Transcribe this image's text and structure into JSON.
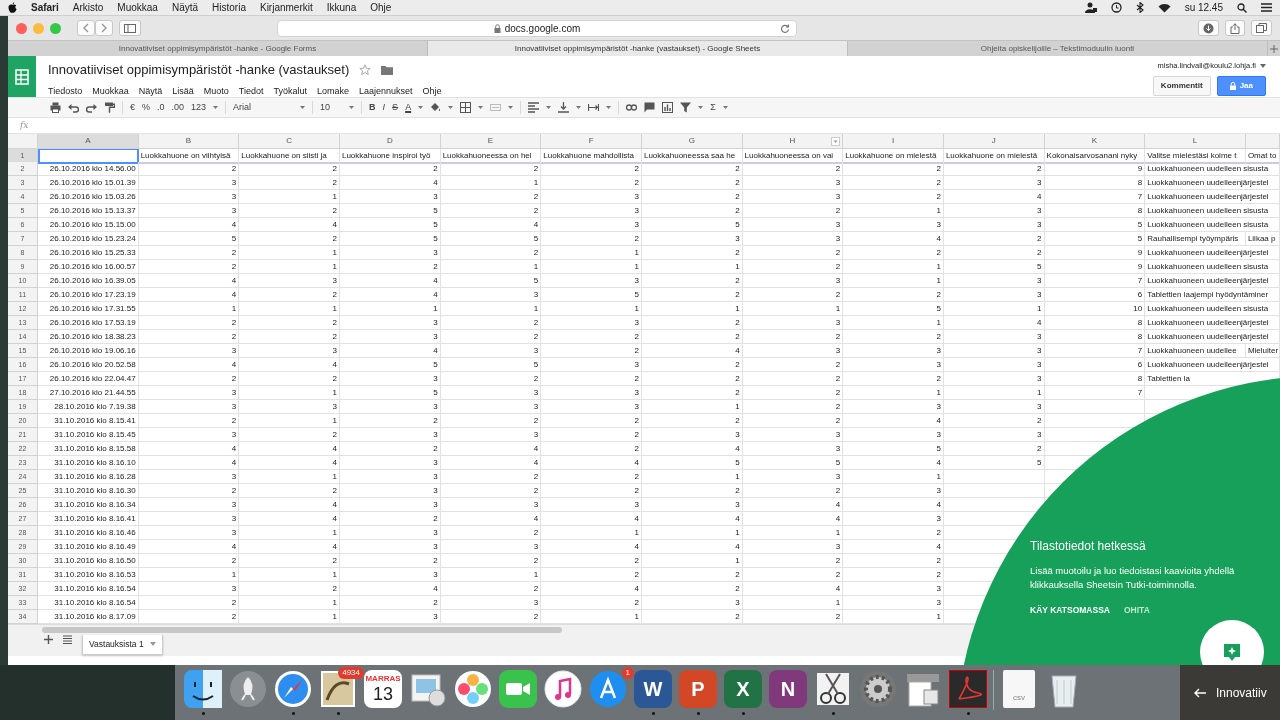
{
  "menubar": {
    "app_name": "Safari",
    "items": [
      "Arkisto",
      "Muokkaa",
      "Näytä",
      "Historia",
      "Kirjanmerkit",
      "Ikkuna",
      "Ohje"
    ],
    "clock": "su 12.45"
  },
  "browser": {
    "address": "docs.google.com",
    "tabs": [
      {
        "title": "Innovatiiviset oppimisympäristöt -hanke - Google Forms",
        "selected": false
      },
      {
        "title": "Innovatiiviset oppimisympäristöt -hanke (vastaukset) - Google Sheets",
        "selected": true
      },
      {
        "title": "Ohjeita opiskelijoille – Tekstimoduulin luonti",
        "selected": false
      }
    ]
  },
  "document": {
    "title": "Innovatiiviset oppimisympäristöt -hanke (vastaukset)",
    "account": "misha.lindvall@koulu2.lohja.fi",
    "comments_button": "Kommentit",
    "share_button": "Jaa",
    "menus": [
      "Tiedosto",
      "Muokkaa",
      "Näytä",
      "Lisää",
      "Muoto",
      "Tiedot",
      "Työkalut",
      "Lomake",
      "Laajennukset",
      "Ohje"
    ]
  },
  "toolbar": {
    "number_formats": [
      "€",
      "%",
      ".0",
      ".00",
      "123"
    ],
    "font": "Arial",
    "size": "10",
    "styles": [
      "B",
      "I",
      "S",
      "A"
    ],
    "function": "Σ"
  },
  "formula_bar": {
    "label": "fx"
  },
  "sheet": {
    "columns": [
      {
        "letter": "A",
        "kind": "number",
        "selected": true,
        "has_menu": false
      },
      {
        "letter": "B",
        "kind": "number",
        "selected": false,
        "has_menu": false
      },
      {
        "letter": "C",
        "kind": "number",
        "selected": false,
        "has_menu": false
      },
      {
        "letter": "D",
        "kind": "number",
        "selected": false,
        "has_menu": false
      },
      {
        "letter": "E",
        "kind": "number",
        "selected": false,
        "has_menu": false
      },
      {
        "letter": "F",
        "kind": "number",
        "selected": false,
        "has_menu": false
      },
      {
        "letter": "G",
        "kind": "number",
        "selected": false,
        "has_menu": false
      },
      {
        "letter": "H",
        "kind": "number",
        "selected": false,
        "has_menu": true
      },
      {
        "letter": "I",
        "kind": "number",
        "selected": false,
        "has_menu": false
      },
      {
        "letter": "J",
        "kind": "number",
        "selected": false,
        "has_menu": false
      },
      {
        "letter": "K",
        "kind": "number",
        "selected": false,
        "has_menu": false
      },
      {
        "letter": "L",
        "kind": "text",
        "selected": false,
        "has_menu": false
      },
      {
        "kind": "text",
        "selected": false,
        "has_menu": false
      }
    ],
    "header_row": {
      "n": "1",
      "cells": [
        {
          "selected": true
        },
        {
          "text": "Luokkahuone on viihtyisä",
          "selected": false
        },
        {
          "text": "Luokkahuone on siisti ja",
          "selected": false
        },
        {
          "text": "Luokkahuone inspiroi työ",
          "selected": false
        },
        {
          "text": "Luokkahuoneessa on hel",
          "selected": false
        },
        {
          "text": "Luokkahuone mahdollista",
          "selected": false
        },
        {
          "text": "Luokkahuoneessa saa he",
          "selected": false
        },
        {
          "text": "Luokkahuoneessa on vai",
          "selected": false
        },
        {
          "text": "Luokkahuone on mielestä",
          "selected": false
        },
        {
          "text": "Luokkahuone on mielestä",
          "selected": false
        },
        {
          "text": "Kokonaisarvosanani nyky",
          "selected": false
        },
        {
          "text": "Valitse mielestäsi kolme t",
          "selected": false
        },
        {
          "text": "Omat to",
          "selected": false
        }
      ]
    },
    "rows": [
      {
        "n": "2",
        "cells": [
          "26.10.2016 klo 14.56.00",
          "2",
          "2",
          "2",
          "2",
          "2",
          "2",
          "2",
          "2",
          "2",
          "9",
          "Luokkahuoneen uudelleen sisusta"
        ]
      },
      {
        "n": "3",
        "cells": [
          "26.10.2016 klo 15.01.39",
          "3",
          "2",
          "4",
          "1",
          "2",
          "2",
          "3",
          "2",
          "3",
          "8",
          "Luokkahuoneen uudelleenjärjestel"
        ]
      },
      {
        "n": "4",
        "cells": [
          "26.10.2016 klo 15.03.26",
          "3",
          "1",
          "3",
          "2",
          "3",
          "2",
          "3",
          "2",
          "4",
          "7",
          "Luokkahuoneen uudelleenjärjestel"
        ]
      },
      {
        "n": "5",
        "cells": [
          "26.10.2016 klo 15.13.37",
          "3",
          "2",
          "5",
          "2",
          "3",
          "2",
          "2",
          "1",
          "3",
          "8",
          "Luokkahuoneen uudelleen sisusta"
        ]
      },
      {
        "n": "6",
        "cells": [
          "26.10.2016 klo 15.15.00",
          "4",
          "4",
          "5",
          "4",
          "3",
          "5",
          "3",
          "3",
          "3",
          "5",
          "Luokkahuoneen uudelleen sisusta"
        ]
      },
      {
        "n": "7",
        "cells": [
          "26.10.2016 klo 15.23.24",
          "5",
          "2",
          "5",
          "5",
          "2",
          "3",
          "3",
          "4",
          "2",
          "5",
          "Rauhallisempi työympäris",
          "Liikaa p"
        ]
      },
      {
        "n": "8",
        "cells": [
          "26.10.2016 klo 15.25.33",
          "2",
          "1",
          "3",
          "2",
          "1",
          "2",
          "2",
          "2",
          "2",
          "9",
          "Luokkahuoneen uudelleenjärjestel"
        ]
      },
      {
        "n": "9",
        "cells": [
          "26.10.2016 klo 16.00.57",
          "2",
          "1",
          "2",
          "1",
          "1",
          "1",
          "2",
          "1",
          "5",
          "9",
          "Luokkahuoneen uudelleen sisusta"
        ]
      },
      {
        "n": "10",
        "cells": [
          "26.10.2016 klo 16.39.05",
          "4",
          "3",
          "4",
          "5",
          "3",
          "2",
          "3",
          "1",
          "3",
          "7",
          "Luokkahuoneen uudelleenjärjestel"
        ]
      },
      {
        "n": "11",
        "cells": [
          "26.10.2016 klo 17.23.19",
          "4",
          "2",
          "4",
          "3",
          "5",
          "2",
          "2",
          "2",
          "3",
          "6",
          "Tablettien laajempi hyödyntäminer"
        ]
      },
      {
        "n": "12",
        "cells": [
          "26.10.2016 klo 17.31.55",
          "1",
          "1",
          "1",
          "1",
          "1",
          "1",
          "1",
          "5",
          "1",
          "10",
          "Luokkahuoneen uudelleen sisusta"
        ]
      },
      {
        "n": "13",
        "cells": [
          "26.10.2016 klo 17.53.19",
          "2",
          "2",
          "3",
          "2",
          "3",
          "2",
          "3",
          "1",
          "4",
          "8",
          "Luokkahuoneen uudelleenjärjestel"
        ]
      },
      {
        "n": "14",
        "cells": [
          "26.10.2016 klo 18.38.23",
          "2",
          "2",
          "3",
          "2",
          "2",
          "2",
          "2",
          "2",
          "3",
          "8",
          "Luokkahuoneen uudelleenjärjestel"
        ]
      },
      {
        "n": "15",
        "cells": [
          "26.10.2016 klo 19.06.16",
          "3",
          "3",
          "4",
          "3",
          "2",
          "4",
          "3",
          "3",
          "3",
          "7",
          "Luokkahuoneen uudellee",
          "Mieluiter"
        ]
      },
      {
        "n": "16",
        "cells": [
          "26.10.2016 klo 20.52.58",
          "4",
          "4",
          "5",
          "5",
          "3",
          "2",
          "2",
          "3",
          "3",
          "6",
          "Luokkahuoneen uudelleenjärjestel"
        ]
      },
      {
        "n": "17",
        "cells": [
          "26.10.2016 klo 22.04.47",
          "2",
          "2",
          "3",
          "2",
          "2",
          "2",
          "2",
          "2",
          "3",
          "8",
          "Tablettien la"
        ]
      },
      {
        "n": "18",
        "cells": [
          "27.10.2016 klo 21.44.55",
          "3",
          "1",
          "5",
          "3",
          "3",
          "2",
          "2",
          "1",
          "1",
          "7"
        ]
      },
      {
        "n": "19",
        "cells": [
          "28.10.2016 klo 7.19.38",
          "3",
          "3",
          "3",
          "3",
          "3",
          "1",
          "2",
          "3",
          "3"
        ]
      },
      {
        "n": "20",
        "cells": [
          "31.10.2016 klo 8.15.41",
          "2",
          "1",
          "2",
          "2",
          "2",
          "2",
          "2",
          "4",
          "2"
        ]
      },
      {
        "n": "21",
        "cells": [
          "31.10.2016 klo 8.15.45",
          "3",
          "2",
          "3",
          "3",
          "2",
          "3",
          "3",
          "3",
          "3"
        ]
      },
      {
        "n": "22",
        "cells": [
          "31.10.2016 klo 8.15.58",
          "4",
          "4",
          "2",
          "4",
          "2",
          "4",
          "3",
          "5",
          "2"
        ]
      },
      {
        "n": "23",
        "cells": [
          "31.10.2016 klo 8.16.10",
          "4",
          "4",
          "3",
          "4",
          "4",
          "5",
          "5",
          "4",
          "5"
        ]
      },
      {
        "n": "24",
        "cells": [
          "31.10.2016 klo 8.16.28",
          "3",
          "1",
          "3",
          "2",
          "2",
          "1",
          "3",
          "1"
        ]
      },
      {
        "n": "25",
        "cells": [
          "31.10.2016 klo 8.16.30",
          "2",
          "2",
          "3",
          "2",
          "2",
          "2",
          "2",
          "3"
        ]
      },
      {
        "n": "26",
        "cells": [
          "31.10.2016 klo 8.16.34",
          "3",
          "4",
          "3",
          "3",
          "3",
          "3",
          "4",
          "4"
        ]
      },
      {
        "n": "27",
        "cells": [
          "31.10.2016 klo 8.16.41",
          "3",
          "4",
          "2",
          "4",
          "4",
          "4",
          "4",
          "3"
        ]
      },
      {
        "n": "28",
        "cells": [
          "31.10.2016 klo 8.16.46",
          "3",
          "1",
          "3",
          "2",
          "1",
          "1",
          "1",
          "2"
        ]
      },
      {
        "n": "29",
        "cells": [
          "31.10.2016 klo 8.16.49",
          "4",
          "4",
          "3",
          "3",
          "4",
          "4",
          "3",
          "4"
        ]
      },
      {
        "n": "30",
        "cells": [
          "31.10.2016 klo 8.16.50",
          "2",
          "2",
          "2",
          "2",
          "2",
          "1",
          "2",
          "2"
        ]
      },
      {
        "n": "31",
        "cells": [
          "31.10.2016 klo 8.16.53",
          "1",
          "1",
          "3",
          "1",
          "2",
          "2",
          "2",
          "2"
        ]
      },
      {
        "n": "32",
        "cells": [
          "31.10.2016 klo 8.16.54",
          "3",
          "2",
          "4",
          "2",
          "4",
          "2",
          "4",
          "3"
        ]
      },
      {
        "n": "33",
        "cells": [
          "31.10.2016 klo 8.16.54",
          "2",
          "1",
          "2",
          "3",
          "2",
          "3",
          "1",
          "3"
        ]
      },
      {
        "n": "34",
        "cells": [
          "31.10.2016 klo 8.17.09",
          "2",
          "1",
          "3",
          "2",
          "1",
          "2",
          "2",
          "1"
        ]
      }
    ]
  },
  "sheet_tabs": [
    {
      "label": "Vastauksista 1",
      "selected": true
    }
  ],
  "promo": {
    "title": "Tilastotiedot hetkessä",
    "text": "Lisää muotoilu ja luo tiedoistasi kaavioita yhdellä klikkauksella Sheetsin Tutki-toiminnolla.",
    "primary_action": "KÄY KATSOMASSA",
    "secondary_action": "OHITA"
  },
  "dock": [
    {
      "kind": "finder",
      "running": true
    },
    {
      "kind": "launchpad",
      "running": false
    },
    {
      "kind": "safari",
      "running": true
    },
    {
      "kind": "mail",
      "badge": "4934",
      "running": true
    },
    {
      "kind": "calendar",
      "month": "MARRAS",
      "day": "13",
      "running": false
    },
    {
      "kind": "preview",
      "running": false
    },
    {
      "kind": "photos",
      "running": false
    },
    {
      "kind": "facetime",
      "running": false
    },
    {
      "kind": "music",
      "running": false
    },
    {
      "kind": "appstore",
      "badge": "1",
      "running": false
    },
    {
      "kind": "letter",
      "glyph": "W",
      "color": "#2b5797",
      "running": true
    },
    {
      "kind": "letter",
      "glyph": "P",
      "color": "#d24726",
      "running": true
    },
    {
      "kind": "letter",
      "glyph": "X",
      "color": "#217346",
      "running": true
    },
    {
      "kind": "letter",
      "glyph": "N",
      "color": "#80397b",
      "running": false
    },
    {
      "kind": "scissors",
      "running": true
    },
    {
      "kind": "settings",
      "running": false
    },
    {
      "kind": "scanner",
      "running": false
    },
    {
      "kind": "pdf",
      "running": true
    },
    {
      "kind": "separator"
    },
    {
      "kind": "file",
      "glyph": "csv",
      "running": false
    },
    {
      "kind": "trash",
      "running": false
    }
  ],
  "background_window": {
    "title": "Innovatiiv"
  }
}
